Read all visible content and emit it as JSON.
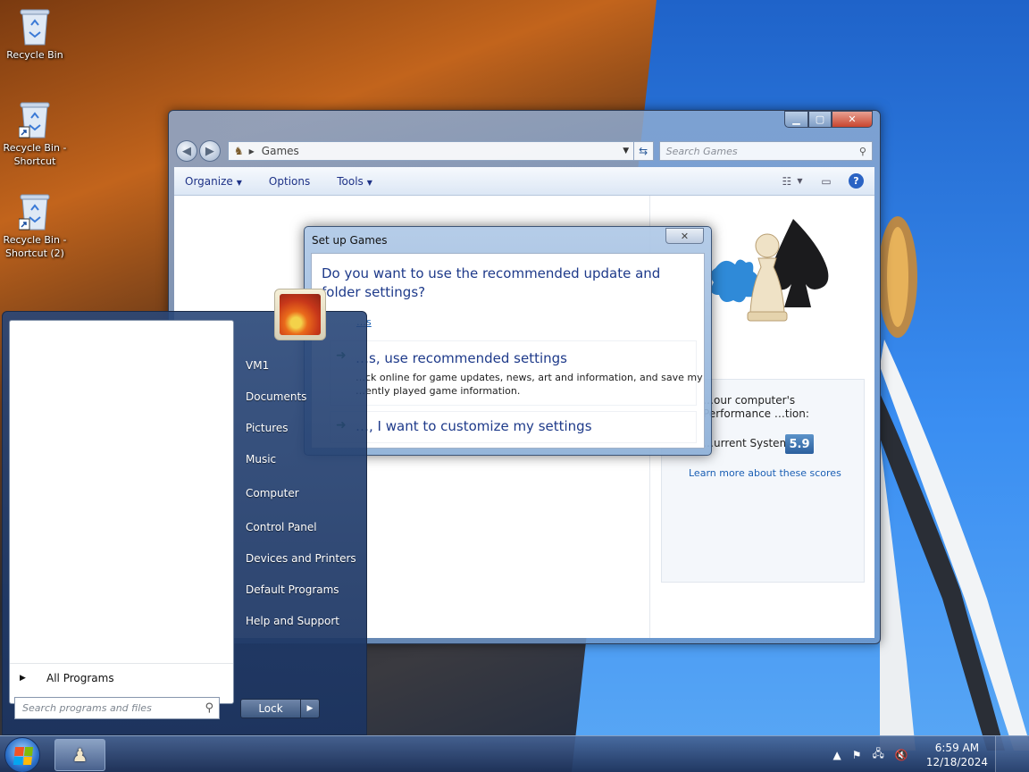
{
  "desktop": {
    "icons": [
      {
        "label": "Recycle Bin",
        "icon": "recycle-bin-icon"
      },
      {
        "label": "Recycle Bin - Shortcut",
        "icon": "recycle-bin-shortcut-icon"
      },
      {
        "label": "Recycle Bin - Shortcut (2)",
        "icon": "recycle-bin-shortcut-icon"
      }
    ]
  },
  "explorer": {
    "address_path": "Games",
    "search_placeholder": "Search Games",
    "toolbar": {
      "organize": "Organize",
      "options": "Options",
      "tools": "Tools"
    },
    "performance": {
      "text": "…our computer's Performance …tion:",
      "system_label": "…urrent System",
      "score": "5.9",
      "learn_more": "Learn more about these scores"
    }
  },
  "dialog": {
    "title": "Set up Games",
    "question": "Do you want to use the recommended update and folder settings?",
    "partial_link": "…s",
    "option1_title": "…s, use recommended settings",
    "option1_desc": "…ck online for game updates, news, art and information, and save my …ently played game information.",
    "option2_title": "…, I want to customize my settings"
  },
  "start_menu": {
    "all_programs": "All Programs",
    "search_placeholder": "Search programs and files",
    "right_items": [
      "VM1",
      "Documents",
      "Pictures",
      "Music",
      "Computer",
      "Control Panel",
      "Devices and Printers",
      "Default Programs",
      "Help and Support"
    ],
    "lock_label": "Lock"
  },
  "taskbar": {
    "time": "6:59 AM",
    "date": "12/18/2024"
  }
}
